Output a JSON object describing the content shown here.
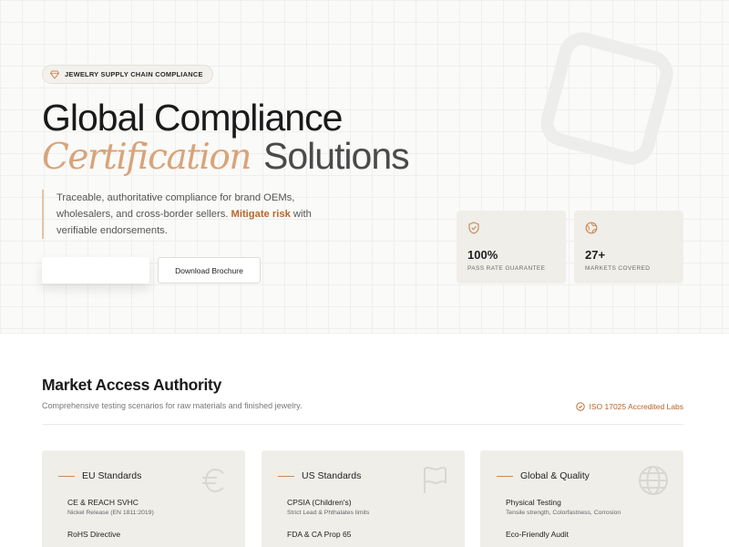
{
  "hero": {
    "badge": "JEWELRY SUPPLY CHAIN COMPLIANCE",
    "title_line1": "Global Compliance",
    "title_italic": "Certification",
    "title_rest": "Solutions",
    "description_before": "Traceable, authoritative compliance for brand OEMs, wholesalers, and cross-border sellers. ",
    "description_highlight": "Mitigate risk",
    "description_after": " with verifiable endorsements.",
    "primary_button": "",
    "secondary_button": "Download Brochure",
    "stats": [
      {
        "icon": "shield-check-icon",
        "value": "100%",
        "label": "PASS RATE GUARANTEE"
      },
      {
        "icon": "globe-icon",
        "value": "27+",
        "label": "MARKETS COVERED"
      }
    ]
  },
  "market": {
    "title": "Market Access Authority",
    "subtitle": "Comprehensive testing scenarios for raw materials and finished jewelry.",
    "iso_label": "ISO 17025 Accredited Labs",
    "cards": [
      {
        "title": "EU Standards",
        "icon": "euro-icon",
        "items": [
          {
            "title": "CE & REACH SVHC",
            "sub": "Nickel Release (EN 1811:2019)"
          },
          {
            "title": "RoHS Directive",
            "sub": ""
          }
        ]
      },
      {
        "title": "US Standards",
        "icon": "flag-icon",
        "items": [
          {
            "title": "CPSIA (Children's)",
            "sub": "Strict Lead & Phthalates limits"
          },
          {
            "title": "FDA & CA Prop 65",
            "sub": ""
          }
        ]
      },
      {
        "title": "Global & Quality",
        "icon": "globe-icon",
        "items": [
          {
            "title": "Physical Testing",
            "sub": "Tensile strength, Colorfastness, Corrosion"
          },
          {
            "title": "Eco-Friendly Audit",
            "sub": ""
          }
        ]
      }
    ]
  },
  "colors": {
    "accent": "#b8672a",
    "accent_light": "#d9a478",
    "card_bg": "#efeee9"
  }
}
